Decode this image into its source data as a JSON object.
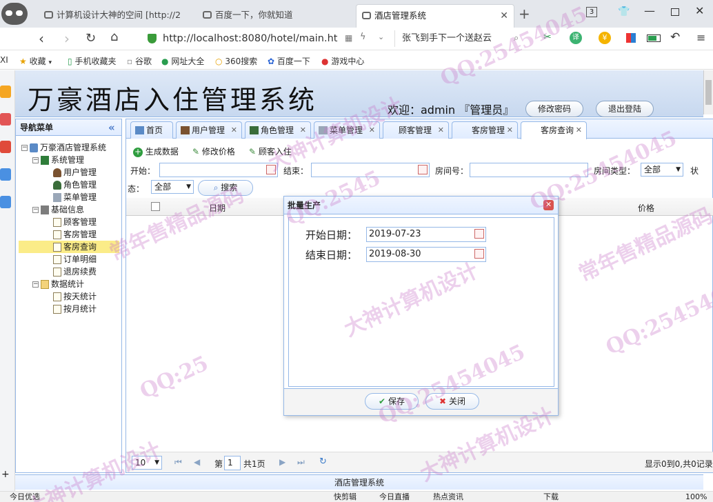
{
  "browser": {
    "tabs": [
      {
        "title": "计算机设计大神的空间 [http://2"
      },
      {
        "title": "百度一下，你就知道"
      },
      {
        "title": "酒店管理系统"
      }
    ],
    "tab_count": "3",
    "url": "http://localhost:8080/hotel/main.ht",
    "search_text": "张飞到手下一个送赵云",
    "bookmarks": [
      "收藏",
      "手机收藏夹",
      "谷歌",
      "网址大全",
      "360搜索",
      "百度一下",
      "游戏中心"
    ],
    "bookmarks_left": "XI",
    "status_left": "今日优选",
    "status_items": [
      "快剪辑",
      "今日直播",
      "热点资讯",
      "下载"
    ],
    "zoom": "100%"
  },
  "app": {
    "title": "万豪酒店入住管理系统",
    "welcome": "欢迎：admin 『管理员』",
    "change_password": "修改密码",
    "logout": "退出登陆",
    "footer": "酒店管理系统"
  },
  "nav": {
    "title": "导航菜单",
    "collapse": "«",
    "root": "万豪酒店管理系统",
    "groups": [
      {
        "label": "系统管理",
        "items": [
          "用户管理",
          "角色管理",
          "菜单管理"
        ]
      },
      {
        "label": "基础信息",
        "items": [
          "顾客管理",
          "客房管理",
          "客房查询",
          "订单明细",
          "退房续费"
        ]
      },
      {
        "label": "数据统计",
        "items": [
          "按天统计",
          "按月统计"
        ]
      }
    ]
  },
  "tabs": [
    {
      "label": "首页"
    },
    {
      "label": "用户管理"
    },
    {
      "label": "角色管理"
    },
    {
      "label": "菜单管理"
    },
    {
      "label": "顾客管理"
    },
    {
      "label": "客房管理"
    },
    {
      "label": "客房查询"
    }
  ],
  "toolbar": {
    "generate": "生成数据",
    "edit_price": "修改价格",
    "checkin": "顾客入住"
  },
  "filters": {
    "start_label": "开始：",
    "end_label": "结束：",
    "room_label": "房间号：",
    "room_type_label": "房间类型：",
    "room_type_value": "全部",
    "status_label_a": "状",
    "status_label_b": "态：",
    "status_value": "全部",
    "search": "搜索"
  },
  "grid": {
    "columns": [
      "日期",
      "价格"
    ]
  },
  "pager": {
    "page_size": "10",
    "page_prefix": "第",
    "page": "1",
    "total_pages": "共1页",
    "info": "显示0到0,共0记录"
  },
  "dialog": {
    "title": "批量生产",
    "start_label": "开始日期：",
    "start_value": "2019-07-23",
    "end_label": "结束日期：",
    "end_value": "2019-08-30",
    "save": "保存",
    "close": "关闭"
  },
  "watermark": {
    "qq": "QQ:25454045",
    "qq_b": "QQ:2545",
    "qq_c": "QQ:25",
    "text1": "大神计算机设计",
    "text2": "常年售精品源码",
    "text3": "常年售精品源码",
    "text4": "大神计算机设计"
  },
  "colors": {
    "accent": "#95b8e7",
    "selected": "#fbec88",
    "header_bg": "#e0ecff"
  }
}
